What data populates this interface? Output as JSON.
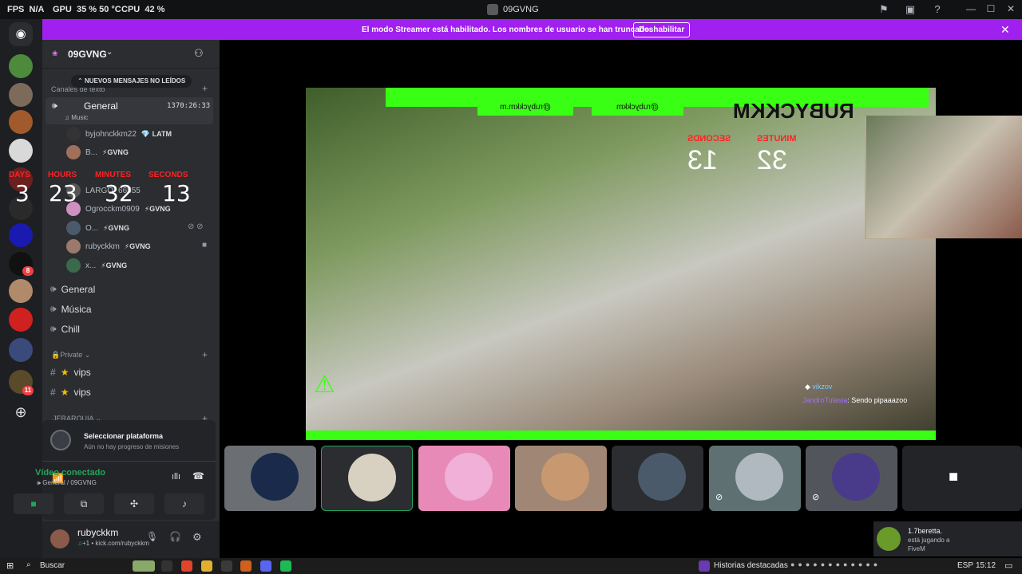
{
  "overlay_stats": {
    "fps_label": "FPS",
    "fps_value": "N/A",
    "gpu_label": "GPU",
    "gpu_value": "35 % 50 °C",
    "cpu_label": "CPU",
    "cpu_value": "42 %"
  },
  "window": {
    "title": "09GVNG"
  },
  "banner": {
    "message": "El modo Streamer está habilitado. Los nombres de usuario se han truncado.",
    "button": "Deshabilitar"
  },
  "rail": {
    "badges": [
      "8",
      "11"
    ]
  },
  "server": {
    "name": "09GVNG",
    "unread_pill": "NUEVOS MENSAJES NO LEÍDOS",
    "text_category": "Canales de texto"
  },
  "voice_channel": {
    "name": "General",
    "status": "Music",
    "timer": "1370:26:33"
  },
  "members": [
    {
      "name": "byjohnckkm22",
      "tag": "LATM"
    },
    {
      "name": "B...",
      "tag": "GVNG"
    },
    {
      "name": "LARGO",
      "tag": "66555"
    },
    {
      "name": "Ogrocckm0909",
      "tag": "GVNG"
    },
    {
      "name": "O...",
      "tag": "GVNG"
    },
    {
      "name": "rubyckkm",
      "tag": "GVNG"
    },
    {
      "name": "x...",
      "tag": "GVNG"
    }
  ],
  "countdown": {
    "days_label": "DAYS",
    "days": "3",
    "hours_label": "HOURS",
    "hours": "23",
    "minutes_label": "MINUTES",
    "minutes": "32",
    "seconds_label": "SECONDS",
    "seconds": "13"
  },
  "channels": [
    "General",
    "Música",
    "Chill"
  ],
  "private_category": "Private",
  "private_channels": [
    "vips",
    "vips"
  ],
  "hierarchy_category": "JERARQUIA",
  "platform": {
    "title": "Seleccionar plataforma",
    "subtitle": "Aún no hay progreso de misiones"
  },
  "voice": {
    "status": "Vídeo conectado",
    "location": "General / 09GVNG"
  },
  "user": {
    "name": "rubyckkm",
    "status": "kick.com/rubyckkm"
  },
  "video_overlay": {
    "handle_ig": "@rubyckkm.m",
    "handle_tt": "@rubyckkm",
    "name_mirror": "RUBYCKKM",
    "seconds_label": "SECONDS",
    "seconds": "13",
    "minutes_label": "MINUTES",
    "minutes": "32",
    "chat": [
      {
        "user": "vikzov",
        "text": ""
      },
      {
        "user": "JandroTulasia",
        "text": "Sendo pipaaazoo"
      }
    ]
  },
  "toast": {
    "title": "1.7beretta.",
    "sub": "está jugando a",
    "game": "FiveM"
  },
  "taskbar": {
    "search": "Buscar",
    "widget": "Historias destacadas",
    "lang": "ESP",
    "time": "15:12"
  },
  "colors": {
    "accent": "#a020f0",
    "green": "#23a55a",
    "neon": "#39ff14",
    "red": "#ff2222"
  }
}
